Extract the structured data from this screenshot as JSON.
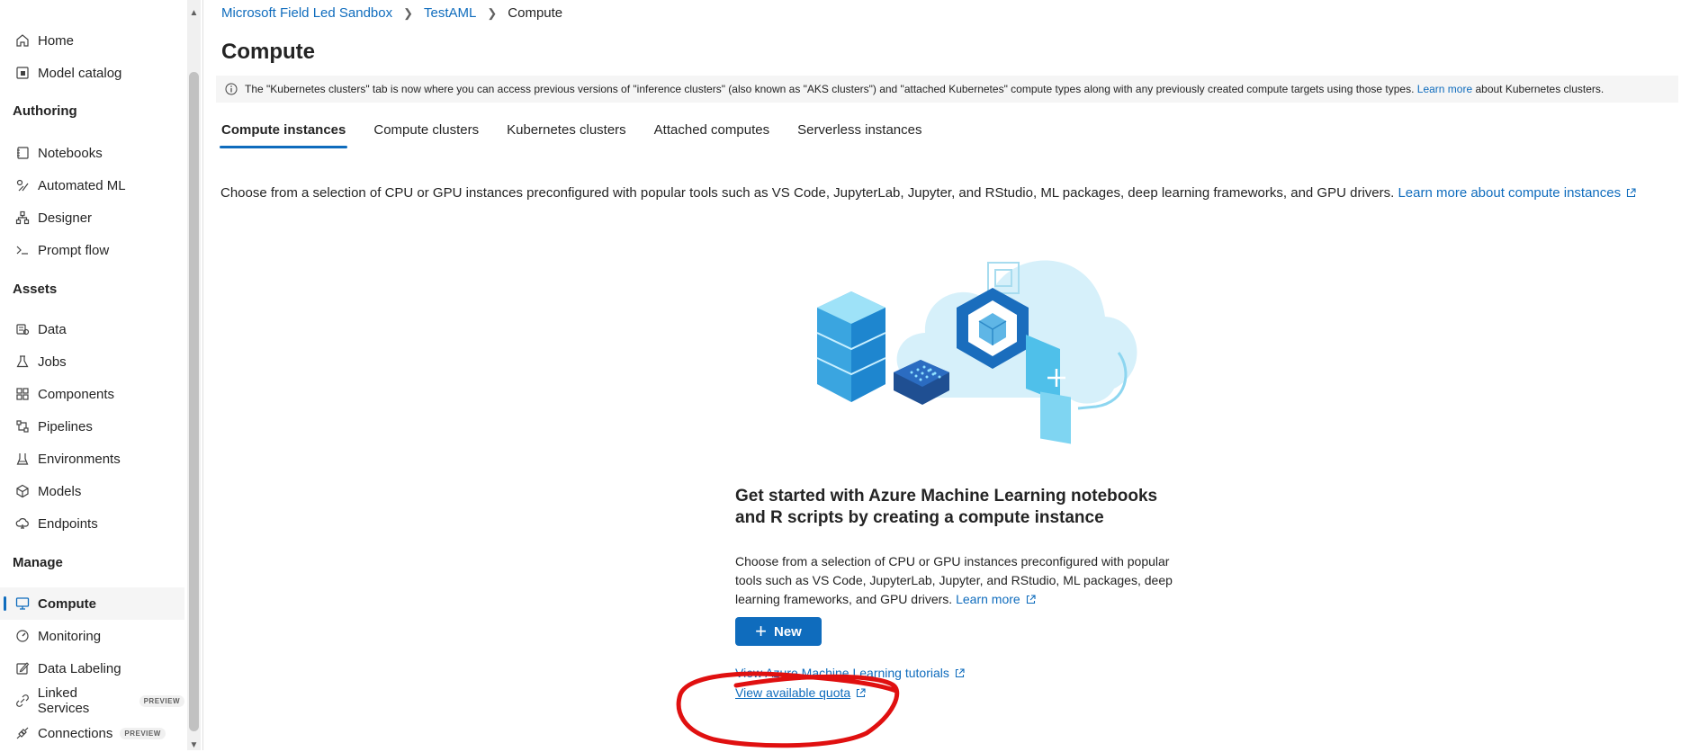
{
  "sidebar": {
    "top_items": [
      {
        "label": "Home",
        "icon": "home-icon"
      },
      {
        "label": "Model catalog",
        "icon": "model-catalog-icon"
      }
    ],
    "sections": {
      "authoring": "Authoring",
      "assets": "Assets",
      "manage": "Manage"
    },
    "authoring_items": [
      {
        "label": "Notebooks",
        "icon": "notebook-icon"
      },
      {
        "label": "Automated ML",
        "icon": "automated-ml-icon"
      },
      {
        "label": "Designer",
        "icon": "designer-icon"
      },
      {
        "label": "Prompt flow",
        "icon": "prompt-flow-icon"
      }
    ],
    "assets_items": [
      {
        "label": "Data",
        "icon": "data-icon"
      },
      {
        "label": "Jobs",
        "icon": "jobs-icon"
      },
      {
        "label": "Components",
        "icon": "components-icon"
      },
      {
        "label": "Pipelines",
        "icon": "pipelines-icon"
      },
      {
        "label": "Environments",
        "icon": "environments-icon"
      },
      {
        "label": "Models",
        "icon": "models-icon"
      },
      {
        "label": "Endpoints",
        "icon": "endpoints-icon"
      }
    ],
    "manage_items": [
      {
        "label": "Compute",
        "icon": "compute-icon",
        "active": true
      },
      {
        "label": "Monitoring",
        "icon": "monitoring-icon"
      },
      {
        "label": "Data Labeling",
        "icon": "data-labeling-icon"
      },
      {
        "label": "Linked Services",
        "icon": "linked-services-icon",
        "badge": "PREVIEW"
      },
      {
        "label": "Connections",
        "icon": "connections-icon",
        "badge": "PREVIEW"
      }
    ]
  },
  "breadcrumb": [
    "Microsoft Field Led Sandbox",
    "TestAML",
    "Compute"
  ],
  "page_title": "Compute",
  "info_bar": {
    "text": "The \"Kubernetes clusters\" tab is now where you can access previous versions of \"inference clusters\" (also known as \"AKS clusters\") and \"attached Kubernetes\" compute types along with any previously created compute targets using those types.",
    "link": "Learn more",
    "suffix": "about Kubernetes clusters."
  },
  "tabs": [
    "Compute instances",
    "Compute clusters",
    "Kubernetes clusters",
    "Attached computes",
    "Serverless instances"
  ],
  "description": {
    "text": "Choose from a selection of CPU or GPU instances preconfigured with popular tools such as VS Code, JupyterLab, Jupyter, and RStudio, ML packages, deep learning frameworks, and GPU drivers.",
    "link": "Learn more about compute instances"
  },
  "empty_state": {
    "title": "Get started with Azure Machine Learning notebooks and R scripts by creating a compute instance",
    "body": "Choose from a selection of CPU or GPU instances preconfigured with popular tools such as VS Code, JupyterLab, Jupyter, and RStudio, ML packages, deep learning frameworks, and GPU drivers.",
    "body_link": "Learn more",
    "new_button": "New",
    "tutorials_link": "View Azure Machine Learning tutorials",
    "quota_link": "View available quota"
  },
  "colors": {
    "accent": "#0f6cbd",
    "annotation": "#e01010"
  }
}
